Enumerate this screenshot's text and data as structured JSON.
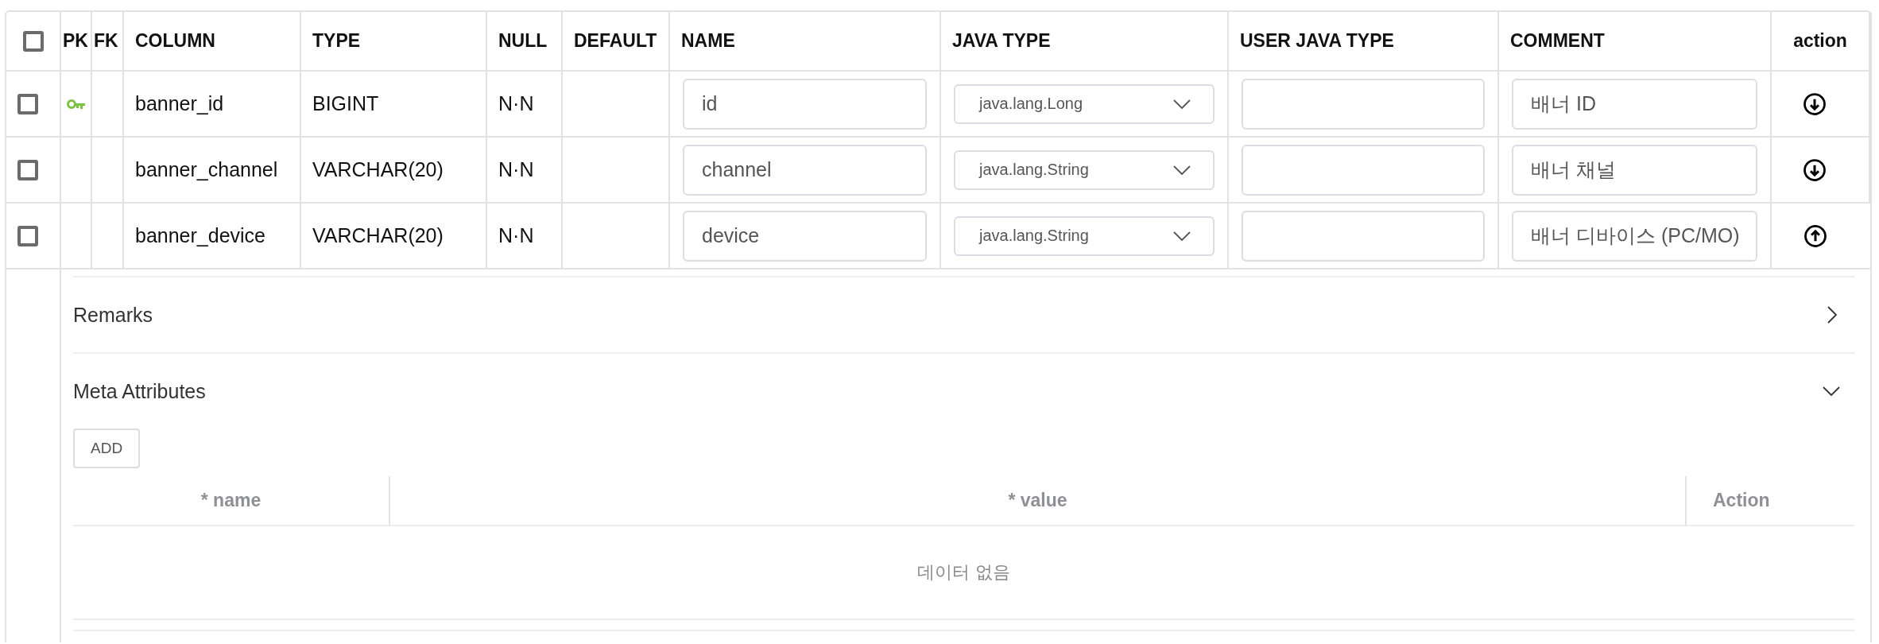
{
  "table": {
    "select_all": {
      "checked": false
    },
    "columns": [
      "PK",
      "FK",
      "COLUMN",
      "TYPE",
      "NULL",
      "DEFAULT",
      "NAME",
      "JAVA TYPE",
      "USER JAVA TYPE",
      "COMMENT",
      "action"
    ],
    "rows": [
      {
        "checked": false,
        "pk": true,
        "column": "banner_id",
        "type": "BIGINT",
        "null": "N·N",
        "name": "id",
        "java_type": "java.lang.Long",
        "comment": "배너 ID",
        "action": {
          "kind": "down"
        }
      },
      {
        "checked": false,
        "pk": false,
        "column": "banner_channel",
        "type": "VARCHAR(20)",
        "null": "N·N",
        "name": "channel",
        "java_type": "java.lang.String",
        "comment": "배너 채널",
        "action": {
          "kind": "down"
        }
      },
      {
        "checked": false,
        "pk": false,
        "column": "banner_device",
        "type": "VARCHAR(20)",
        "null": "N·N",
        "name": "device",
        "java_type": "java.lang.String",
        "comment": "배너 디바이스 (PC/MO)",
        "action": {
          "kind": "up"
        }
      }
    ]
  },
  "details": {
    "sections": [
      {
        "title": "Remarks",
        "expanded": false
      },
      {
        "title": "Meta Attributes",
        "expanded": true,
        "add_button": "ADD",
        "table": {
          "columns": [
            "* name",
            "* value",
            "Action"
          ],
          "empty_text": "데이터 없음"
        }
      }
    ]
  }
}
